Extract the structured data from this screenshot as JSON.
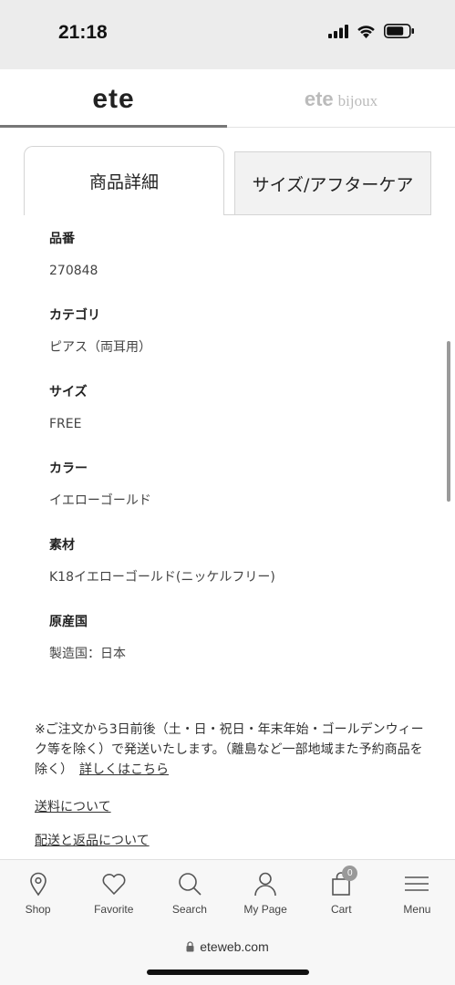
{
  "status_bar": {
    "time": "21:18"
  },
  "brand_tabs": {
    "ete": "ete",
    "bijoux_brand": "ete",
    "bijoux_suffix": "bijoux"
  },
  "tabs": {
    "details": "商品詳細",
    "size_care": "サイズ/アフターケア"
  },
  "specs": [
    {
      "label": "品番",
      "value": "270848"
    },
    {
      "label": "カテゴリ",
      "value": "ピアス（両耳用）"
    },
    {
      "label": "サイズ",
      "value": "FREE"
    },
    {
      "label": "カラー",
      "value": "イエローゴールド"
    },
    {
      "label": "素材",
      "value": "K18イエローゴールド(ニッケルフリー)"
    },
    {
      "label": "原産国",
      "value": "製造国：日本"
    }
  ],
  "shipping_note": {
    "text": "※ご注文から3日前後（土・日・祝日・年末年始・ゴールデンウィーク等を除く）で発送いたします。（離島など一部地域また予約商品を除く）",
    "more_link": "詳しくはこちら"
  },
  "links": {
    "shipping_fee": "送料について",
    "delivery_returns": "配送と返品について"
  },
  "bottom_nav": {
    "shop": "Shop",
    "favorite": "Favorite",
    "search": "Search",
    "mypage": "My Page",
    "cart": "Cart",
    "cart_count": "0",
    "menu": "Menu"
  },
  "browser": {
    "url": "eteweb.com"
  }
}
